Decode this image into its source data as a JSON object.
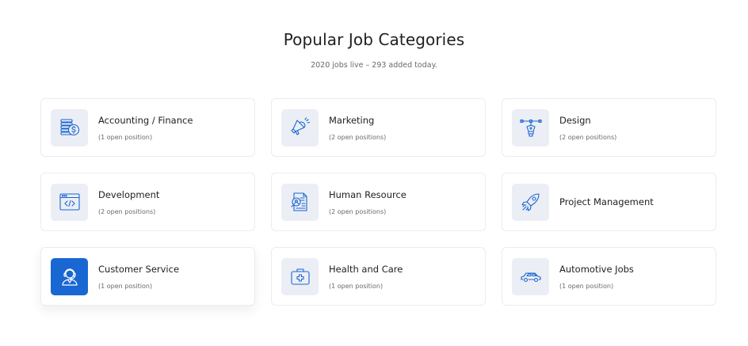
{
  "section": {
    "title": "Popular Job Categories",
    "subtitle": "2020 jobs live – 293 added today."
  },
  "colors": {
    "accent": "#1967d2",
    "icon_bg": "#eceef5",
    "card_border": "#e9ecef"
  },
  "categories": [
    {
      "name": "Accounting / Finance",
      "count": "(1 open position)",
      "icon": "money-stack-icon"
    },
    {
      "name": "Marketing",
      "count": "(2 open positions)",
      "icon": "megaphone-icon"
    },
    {
      "name": "Design",
      "count": "(2 open positions)",
      "icon": "pen-tool-icon"
    },
    {
      "name": "Development",
      "count": "(2 open positions)",
      "icon": "code-window-icon"
    },
    {
      "name": "Human Resource",
      "count": "(2 open positions)",
      "icon": "resume-search-icon"
    },
    {
      "name": "Project Management",
      "count": "",
      "icon": "rocket-icon"
    },
    {
      "name": "Customer Service",
      "count": "(1 open position)",
      "icon": "headset-agent-icon"
    },
    {
      "name": "Health and Care",
      "count": "(1 open position)",
      "icon": "first-aid-kit-icon"
    },
    {
      "name": "Automotive Jobs",
      "count": "(1 open position)",
      "icon": "car-icon"
    }
  ]
}
